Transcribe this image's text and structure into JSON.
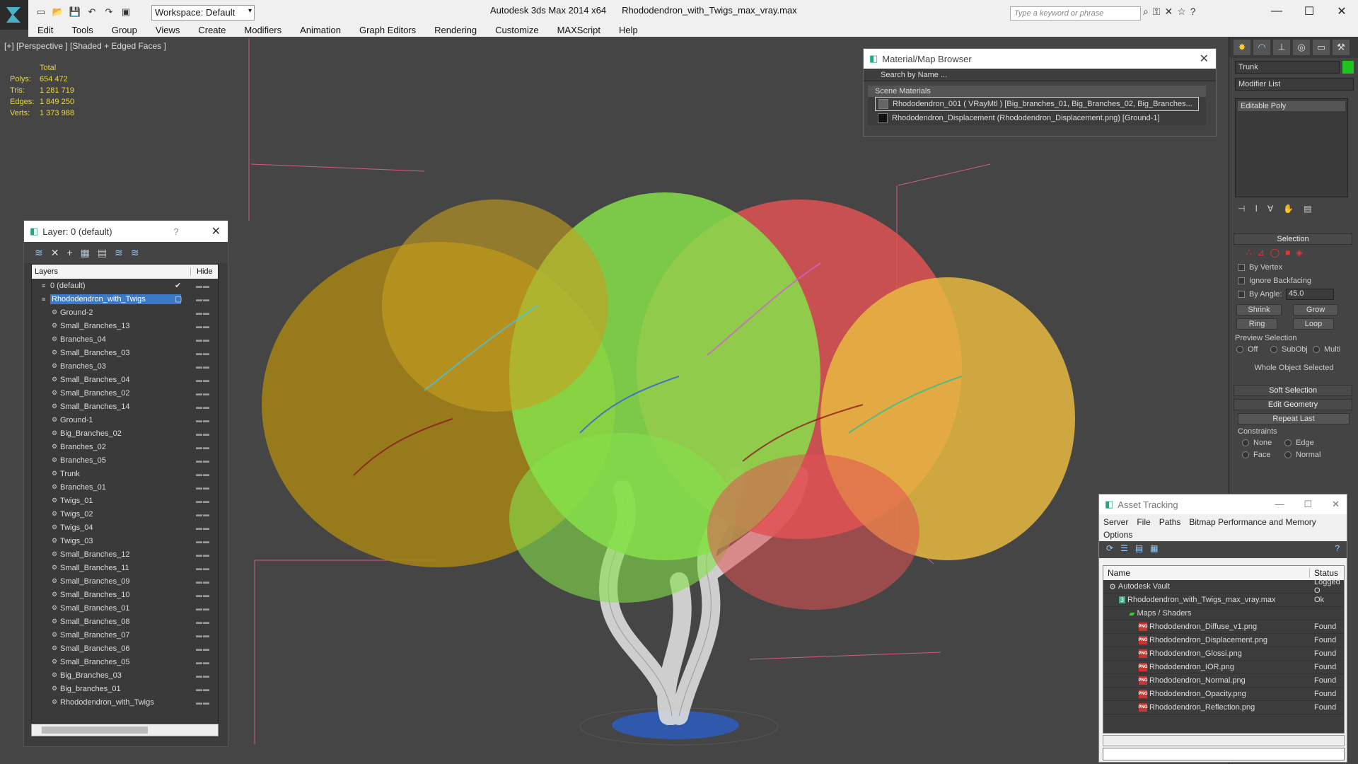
{
  "app": {
    "title": "Autodesk 3ds Max  2014 x64",
    "file": "Rhododendron_with_Twigs_max_vray.max",
    "workspace": "Workspace: Default",
    "search_placeholder": "Type a keyword or phrase"
  },
  "menu": [
    "Edit",
    "Tools",
    "Group",
    "Views",
    "Create",
    "Modifiers",
    "Animation",
    "Graph Editors",
    "Rendering",
    "Customize",
    "MAXScript",
    "Help"
  ],
  "viewport": {
    "label": "[+] [Perspective ] [Shaded + Edged Faces ]"
  },
  "stats": {
    "header": "Total",
    "rows": [
      {
        "k": "Polys:",
        "v": "654 472"
      },
      {
        "k": "Tris:",
        "v": "1 281 719"
      },
      {
        "k": "Edges:",
        "v": "1 849 250"
      },
      {
        "k": "Verts:",
        "v": "1 373 988"
      }
    ]
  },
  "layer_panel": {
    "title": "Layer: 0 (default)",
    "help": "?",
    "col_layers": "Layers",
    "col_hide": "Hide",
    "rows": [
      "0 (default)",
      "Rhododendron_with_Twigs",
      "Ground-2",
      "Small_Branches_13",
      "Branches_04",
      "Small_Branches_03",
      "Branches_03",
      "Small_Branches_04",
      "Small_Branches_02",
      "Small_Branches_14",
      "Ground-1",
      "Big_Branches_02",
      "Branches_02",
      "Branches_05",
      "Trunk",
      "Branches_01",
      "Twigs_01",
      "Twigs_02",
      "Twigs_04",
      "Twigs_03",
      "Small_Branches_12",
      "Small_Branches_11",
      "Small_Branches_09",
      "Small_Branches_10",
      "Small_Branches_01",
      "Small_Branches_08",
      "Small_Branches_07",
      "Small_Branches_06",
      "Small_Branches_05",
      "Big_Branches_03",
      "Big_branches_01",
      "Rhododendron_with_Twigs"
    ]
  },
  "material_browser": {
    "title": "Material/Map Browser",
    "search": "Search by Name ...",
    "section": "Scene Materials",
    "items": [
      "Rhododendron_001  ( VRayMtl ) [Big_branches_01, Big_Branches_02, Big_Branches...",
      "Rhododendron_Displacement (Rhododendron_Displacement.png) [Ground-1]"
    ]
  },
  "command_panel": {
    "object_name": "Trunk",
    "modifier_list": "Modifier List",
    "stack_item": "Editable Poly",
    "selection": "Selection",
    "by_vertex": "By Vertex",
    "ignore_backfacing": "Ignore Backfacing",
    "by_angle": "By Angle:",
    "angle": "45.0",
    "shrink": "Shrink",
    "grow": "Grow",
    "ring": "Ring",
    "loop": "Loop",
    "preview": "Preview Selection",
    "off": "Off",
    "subobj": "SubObj",
    "multi": "Multi",
    "whole": "Whole Object Selected",
    "soft": "Soft Selection",
    "edit_geo": "Edit Geometry",
    "repeat": "Repeat Last",
    "constraints": "Constraints",
    "none": "None",
    "edge": "Edge",
    "face": "Face",
    "normal": "Normal",
    "accent": "#1fc21f"
  },
  "asset_tracking": {
    "title": "Asset Tracking",
    "menu": [
      "Server",
      "File",
      "Paths",
      "Bitmap Performance and Memory"
    ],
    "options": "Options",
    "col_name": "Name",
    "col_status": "Status",
    "rows": [
      {
        "name": "Autodesk Vault",
        "status": "Logged O",
        "indent": 0,
        "icon": "vault"
      },
      {
        "name": "Rhododendron_with_Twigs_max_vray.max",
        "status": "Ok",
        "indent": 1,
        "icon": "max"
      },
      {
        "name": "Maps / Shaders",
        "status": "",
        "indent": 2,
        "icon": "folder"
      },
      {
        "name": "Rhododendron_Diffuse_v1.png",
        "status": "Found",
        "indent": 3,
        "icon": "png"
      },
      {
        "name": "Rhododendron_Displacement.png",
        "status": "Found",
        "indent": 3,
        "icon": "png"
      },
      {
        "name": "Rhododendron_Glossi.png",
        "status": "Found",
        "indent": 3,
        "icon": "png"
      },
      {
        "name": "Rhododendron_IOR.png",
        "status": "Found",
        "indent": 3,
        "icon": "png"
      },
      {
        "name": "Rhododendron_Normal.png",
        "status": "Found",
        "indent": 3,
        "icon": "png"
      },
      {
        "name": "Rhododendron_Opacity.png",
        "status": "Found",
        "indent": 3,
        "icon": "png"
      },
      {
        "name": "Rhododendron_Reflection.png",
        "status": "Found",
        "indent": 3,
        "icon": "png"
      }
    ]
  }
}
